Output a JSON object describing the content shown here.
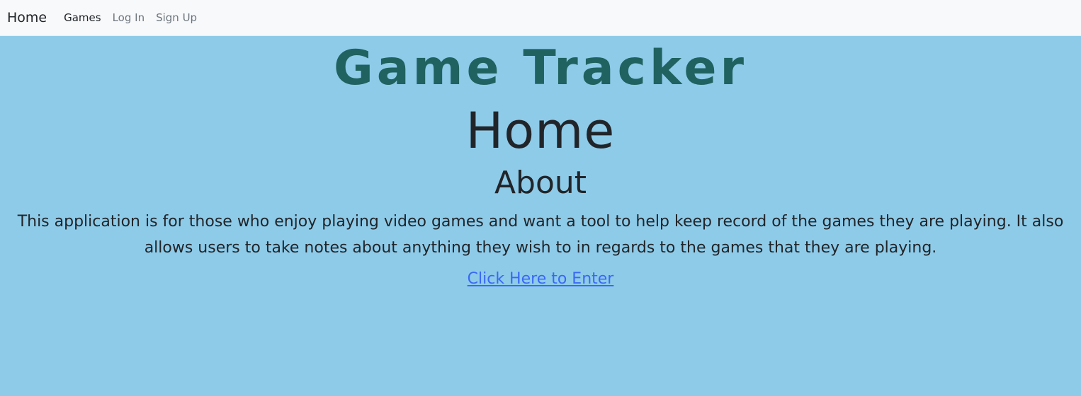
{
  "nav": {
    "brand": "Home",
    "links": [
      {
        "label": "Games"
      },
      {
        "label": "Log In"
      },
      {
        "label": "Sign Up"
      }
    ]
  },
  "main": {
    "site_title": "Game Tracker",
    "page_title": "Home",
    "about_heading": "About",
    "about_text": "This application is for those who enjoy playing video games and want a tool to help keep record of the games they are playing. It also allows users to take notes about anything they wish to in regards to the games that they are playing.",
    "enter_link": "Click Here to Enter"
  },
  "colors": {
    "background": "#8ecbe9",
    "navbar": "#f8f9fa",
    "title": "#1f625f",
    "link": "#3a68f5"
  }
}
